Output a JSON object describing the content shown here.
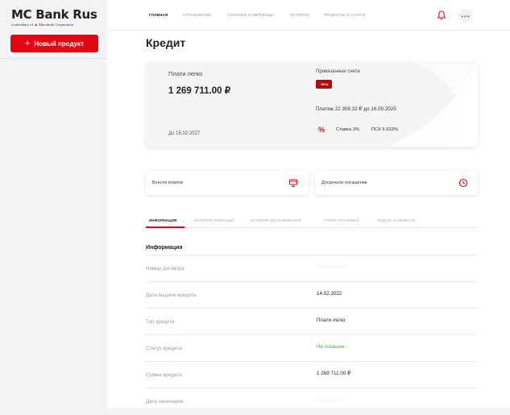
{
  "brand": {
    "name": "MC Bank Rus",
    "subtitle_prefix": "a subsidiary of",
    "subtitle_corp": "Mitsubishi Corporation"
  },
  "sidebar": {
    "new_product": "Новый продукт"
  },
  "topnav": {
    "items": [
      "Главная",
      "Страхование",
      "Платежи и переводы",
      "История",
      "Продукты и услуги"
    ],
    "more_label": "•••"
  },
  "page": {
    "title": "Кредит"
  },
  "card": {
    "name": "Плати легко",
    "amount": "1 269 711.00 ₽",
    "until": "До 15.02.2027",
    "linked_label": "Привязанные счета",
    "linked_chip": "··9014",
    "payment": "Платеж 22 308.32 ₽ до 16.09.2025",
    "percent_symbol": "%",
    "rate": "Ставка 3%",
    "psk": "ПСК 6.933%"
  },
  "actions": {
    "pay": "Внести платёж",
    "early": "Досрочное погашение"
  },
  "tabs": [
    "Информация",
    "История операций",
    "История обслуживания",
    "График платежей",
    "Подать заявление"
  ],
  "info": {
    "title": "Информация",
    "rows": [
      {
        "label": "Номер договора",
        "value": "00000000000"
      },
      {
        "label": "Дата выдачи кредита",
        "value": "14.02.2022"
      },
      {
        "label": "Тип кредита",
        "value": "Плати легко"
      },
      {
        "label": "Статус кредита",
        "value": "Не погашен"
      },
      {
        "label": "Сумма кредита",
        "value": "1 269 711.00 ₽"
      },
      {
        "label": "Дата окончания",
        "value": "00.00.0000"
      }
    ]
  },
  "colors": {
    "accent": "#e30613",
    "status_ok": "#3cb83a"
  }
}
